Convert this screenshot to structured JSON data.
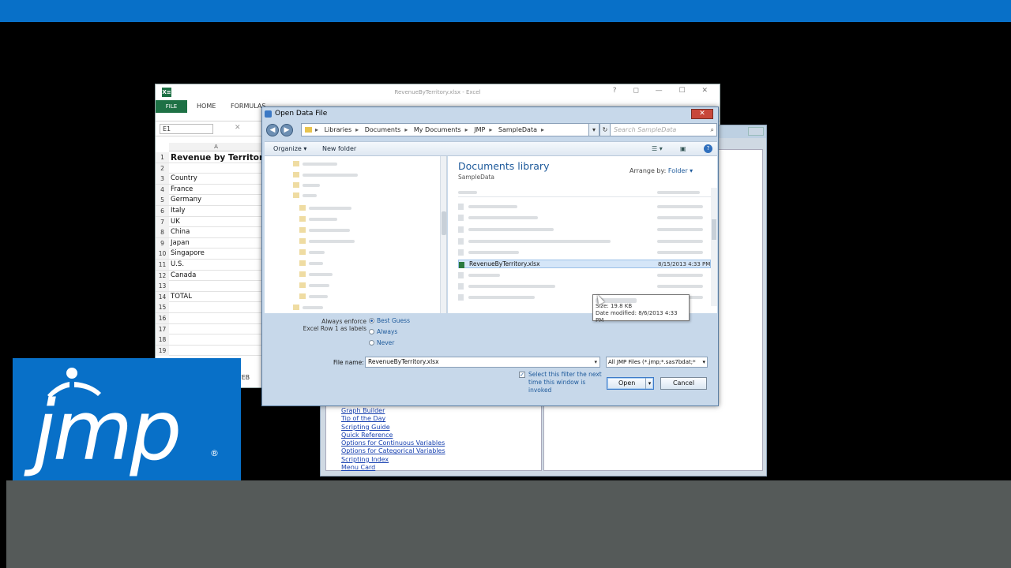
{
  "excel": {
    "logo_text": "X≡",
    "title": "RevenueByTerritory.xlsx - Excel",
    "window_buttons": "?  ◻  —  ☐  ✕",
    "ribbon": {
      "file_tab": "FILE",
      "home_tab": "HOME",
      "formulas_tab": "FORMULAS"
    },
    "name_box": "E1",
    "formula_cancel": "✕",
    "column_a": "A",
    "rows": [
      {
        "n": "1",
        "v": "Revenue by Territory"
      },
      {
        "n": "2",
        "v": ""
      },
      {
        "n": "3",
        "v": "Country"
      },
      {
        "n": "4",
        "v": "France"
      },
      {
        "n": "5",
        "v": "Germany"
      },
      {
        "n": "6",
        "v": "Italy"
      },
      {
        "n": "7",
        "v": "UK"
      },
      {
        "n": "8",
        "v": "China"
      },
      {
        "n": "9",
        "v": "Japan"
      },
      {
        "n": "10",
        "v": "Singapore"
      },
      {
        "n": "11",
        "v": "U.S."
      },
      {
        "n": "12",
        "v": "Canada"
      },
      {
        "n": "13",
        "v": ""
      },
      {
        "n": "14",
        "v": "TOTAL"
      },
      {
        "n": "15",
        "v": ""
      },
      {
        "n": "16",
        "v": ""
      },
      {
        "n": "17",
        "v": ""
      },
      {
        "n": "18",
        "v": ""
      },
      {
        "n": "19",
        "v": ""
      }
    ],
    "sheet_tab": "FEB"
  },
  "jmp_home": {
    "links": [
      "Graph Builder",
      "Tip of the Day",
      "Scripting Guide",
      "Quick Reference",
      "Options for Continuous Variables",
      "Options for Categorical Variables",
      "Scripting Index",
      "Menu Card"
    ]
  },
  "dialog": {
    "title": "Open Data File",
    "close": "✕",
    "breadcrumb": [
      "Libraries",
      "Documents",
      "My Documents",
      "JMP",
      "SampleData"
    ],
    "search_placeholder": "Search SampleData",
    "toolbar": {
      "organize": "Organize ▾",
      "new_folder": "New folder",
      "help": "?"
    },
    "library_title": "Documents library",
    "library_subtitle": "SampleData",
    "arrange_label": "Arrange by:",
    "arrange_value": "Folder ▾",
    "selected_file": {
      "name": "RevenueByTerritory.xlsx",
      "date": "8/15/2013 4:33 PM"
    },
    "tooltip": {
      "size": "Size: 19.8 KB",
      "modified": "Date modified: 8/6/2013 4:33 PM"
    },
    "options": {
      "label_line1": "Always enforce",
      "label_line2": "Excel Row 1 as labels",
      "radio_best": "Best Guess",
      "radio_always": "Always",
      "radio_never": "Never"
    },
    "file_name_label": "File name:",
    "file_name_value": "RevenueByTerritory.xlsx",
    "filter_value": "All JMP Files (*.jmp;*.sas7bdat;*",
    "checkbox_label": "Select this filter the next time this window is invoked",
    "open_button": "Open",
    "cancel_button": "Cancel"
  },
  "logo": {
    "text": "jmp",
    "registered": "®"
  },
  "colors": {
    "brand_blue": "#0870c8",
    "bottom_gray": "#555a59"
  }
}
